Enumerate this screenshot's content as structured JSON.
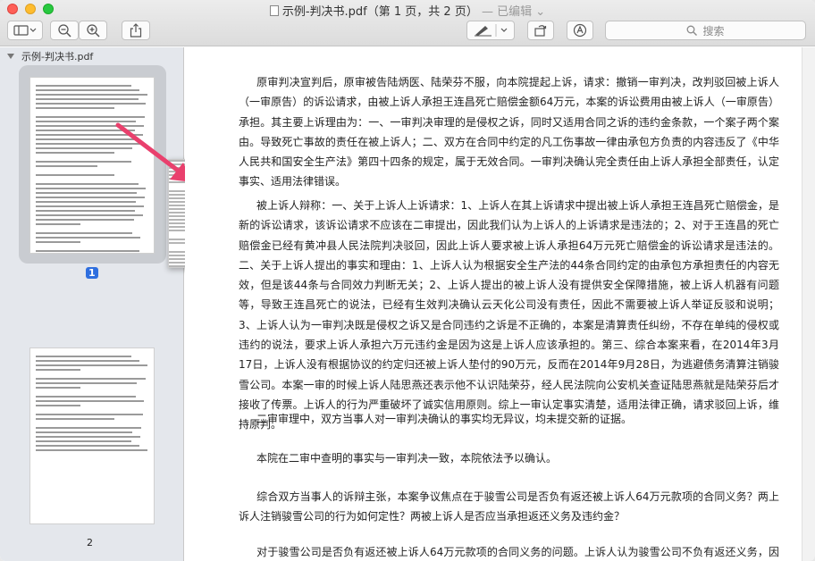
{
  "window": {
    "title": "示例-判决书.pdf（第 1 页，共 2 页）",
    "edited_label": "— 已编辑"
  },
  "toolbar": {
    "search_placeholder": "搜索"
  },
  "sidebar": {
    "file_name": "示例-判决书.pdf",
    "pages": [
      {
        "number": "1",
        "selected": true
      },
      {
        "number": "2",
        "selected": false
      }
    ],
    "drag_page_number": "1"
  },
  "document": {
    "paragraphs": [
      "原审判决宣判后，原审被告陆炳医、陆荣芬不服，向本院提起上诉，请求：撤销一审判决，改判驳回被上诉人（一审原告）的诉讼请求，由被上诉人承担王连昌死亡赔偿金额64万元，本案的诉讼费用由被上诉人（一审原告）承担。其主要上诉理由为：一、一审判决审理的是侵权之诉，同时又适用合同之诉的违约金条款，一个案子两个案由。导致死亡事故的责任在被上诉人；二、双方在合同中约定的凡工伤事故一律由承包方负责的内容违反了《中华人民共和国安全生产法》第四十四条的规定，属于无效合同。一审判决确认完全责任由上诉人承担全部责任，认定事实、适用法律错误。",
      "被上诉人辩称：一、关于上诉人上诉请求：1、上诉人在其上诉请求中提出被上诉人承担王连昌死亡赔偿金，是新的诉讼请求，该诉讼请求不应该在二审提出，因此我们认为上诉人的上诉请求是违法的；2、对于王连昌的死亡赔偿金已经有黄冲县人民法院判决驳回，因此上诉人要求被上诉人承担64万元死亡赔偿金的诉讼请求是违法的。二、关于上诉人提出的事实和理由：1、上诉人认为根据安全生产法的44条合同约定的由承包方承担责任的内容无效，但是该44条与合同效力判断无关；2、上诉人提出的被上诉人没有提供安全保障措施，被上诉人机器有问题等，导致王连昌死亡的说法，已经有生效判决确认云天化公司没有责任，因此不需要被上诉人举证反驳和说明；3、上诉人认为一审判决既是侵权之诉又是合同违约之诉是不正确的，本案是清算责任纠纷，不存在单纯的侵权或违约的说法，要求上诉人承担六万元违约金是因为这是上诉人应该承担的。第三、综合本案来看，在2014年3月17日，上诉人没有根据协议的约定归还被上诉人垫付的90万元，反而在2014年9月28日，为逃避债务清算注销骏雪公司。本案一审的时候上诉人陆思燕还表示他不认识陆荣芬，经人民法院向公安机关查证陆思燕就是陆荣芬后才接收了传票。上诉人的行为严重破坏了诚实信用原则。综上一审认定事实清楚，适用法律正确，请求驳回上诉，维持原判。",
      "二审审理中，双方当事人对一审判决确认的事实均无异议，均未提交新的证据。",
      "本院在二审中查明的事实与一审判决一致，本院依法予以确认。",
      "综合双方当事人的诉辩主张，本案争议焦点在于骏雪公司是否负有返还被上诉人64万元款项的合同义务？两上诉人注销骏雪公司的行为如何定性？两被上诉人是否应当承担返还义务及违约金？",
      "对于骏雪公司是否负有返还被上诉人64万元款项的合同义务的问题。上诉人认为骏雪公司不负有返还义务，因为"
    ]
  }
}
